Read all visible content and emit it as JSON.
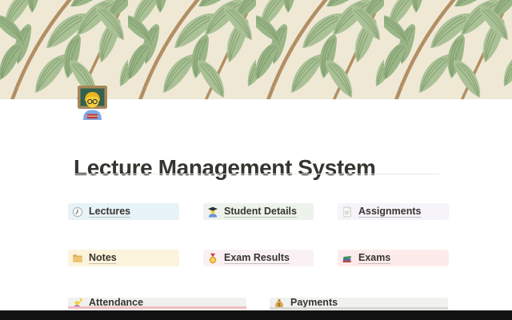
{
  "page": {
    "title": "Lecture Management System",
    "icon": "woman-teacher-icon",
    "cover": "willow-leaf-pattern"
  },
  "colors": {
    "banner_bg": "#efe8d5",
    "leaf_green": "#a9c195",
    "leaf_green_dark": "#9ab586",
    "leaf_vein": "#5f7d52",
    "branch_brown": "#b18f63",
    "text": "#37352f",
    "divider": "#e9e9e7",
    "attendance_sliver": "#f2bdc2",
    "payments_sliver": "#d8d7d4",
    "bottom_bar": "#121212"
  },
  "sections": [
    {
      "label": "Lectures",
      "icon": "clock-icon",
      "bg": "#e7f3f8"
    },
    {
      "label": "Student Details",
      "icon": "student-icon",
      "bg": "#edf3ec"
    },
    {
      "label": "Assignments",
      "icon": "page-icon",
      "bg": "#f6f3f9"
    },
    {
      "label": "Notes",
      "icon": "folder-icon",
      "bg": "#fbf3db"
    },
    {
      "label": "Exam Results",
      "icon": "medal-icon",
      "bg": "#faf1f5"
    },
    {
      "label": "Exams",
      "icon": "books-icon",
      "bg": "#fdebec"
    },
    {
      "label": "Attendance",
      "icon": "raising-hand-icon",
      "bg": "#f1f1ef"
    },
    {
      "label": "Payments",
      "icon": "money-bag-icon",
      "bg": "#f1f1ef"
    }
  ]
}
